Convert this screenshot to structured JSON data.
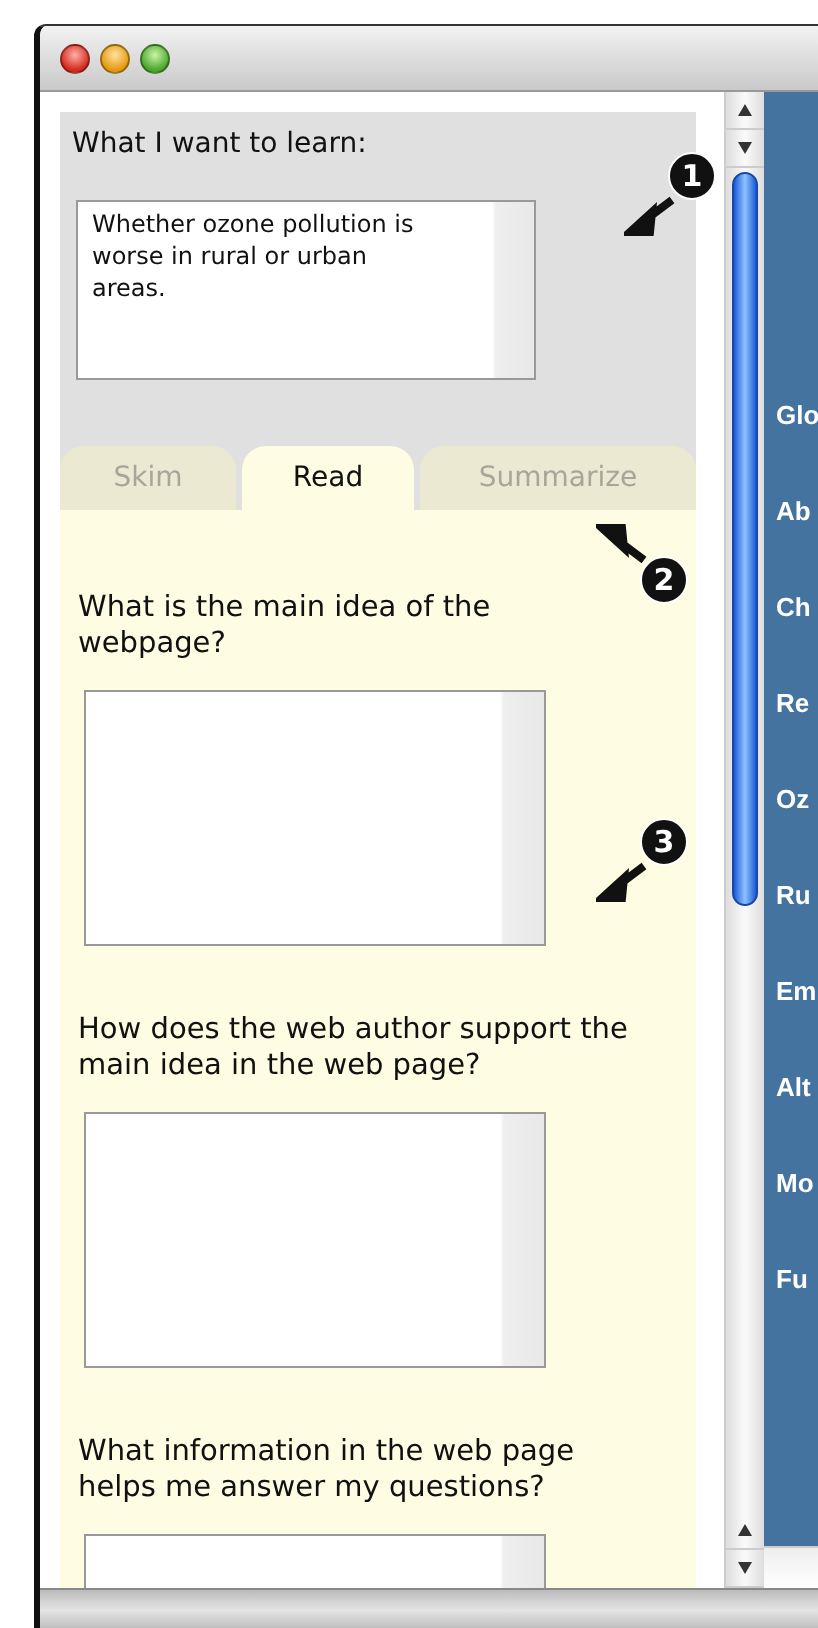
{
  "learn": {
    "label": "What I want to learn:",
    "value": "Whether ozone pollution is worse in rural or urban areas."
  },
  "tabs": [
    {
      "label": "Skim",
      "selected": false
    },
    {
      "label": "Read",
      "selected": true
    },
    {
      "label": "Summarize",
      "selected": false
    }
  ],
  "questions": [
    {
      "prompt": "What is the main idea of the webpage?"
    },
    {
      "prompt": "How does the web author support the main idea in the web page?"
    },
    {
      "prompt": "What information in the web page helps me answer my questions?"
    }
  ],
  "callouts": [
    {
      "label": "1",
      "kind": "down-left"
    },
    {
      "label": "2",
      "kind": "up-left"
    },
    {
      "label": "3",
      "kind": "down-left"
    }
  ],
  "nav": [
    {
      "label": "Glo"
    },
    {
      "label": "Ab"
    },
    {
      "label": "Ch"
    },
    {
      "label": "Re"
    },
    {
      "label": "Oz"
    },
    {
      "label": "Ru"
    },
    {
      "label": "Em"
    },
    {
      "label": "Alt"
    },
    {
      "label": "Mo"
    },
    {
      "label": "Fu"
    }
  ]
}
